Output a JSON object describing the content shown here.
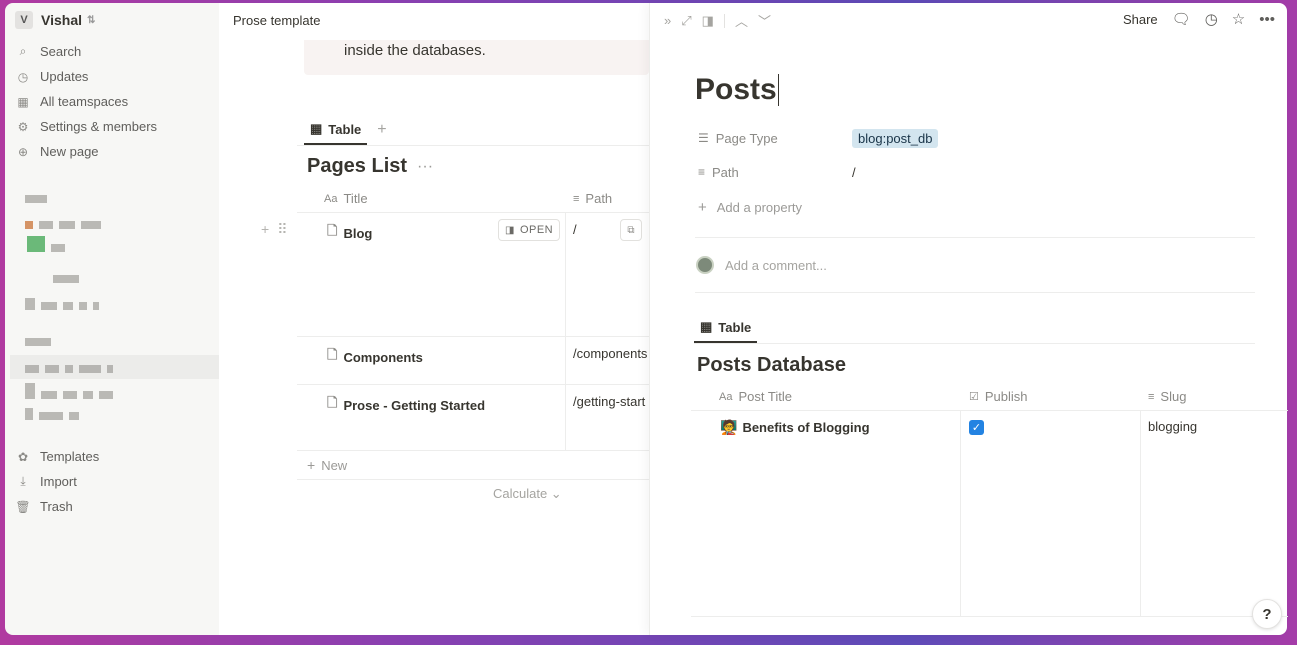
{
  "sidebar": {
    "workspace": {
      "initial": "V",
      "name": "Vishal",
      "chevron": "⇅"
    },
    "nav": [
      {
        "icon": "search-icon",
        "glyph": "⌕",
        "label": "Search"
      },
      {
        "icon": "clock-icon",
        "glyph": "◷",
        "label": "Updates"
      },
      {
        "icon": "teamspaces-icon",
        "glyph": "▦",
        "label": "All teamspaces"
      },
      {
        "icon": "gear-icon",
        "glyph": "⚙",
        "label": "Settings & members"
      },
      {
        "icon": "plus-circle-icon",
        "glyph": "⊕",
        "label": "New page"
      }
    ],
    "bottom": [
      {
        "icon": "templates-icon",
        "glyph": "✿",
        "label": "Templates"
      },
      {
        "icon": "import-icon",
        "glyph": "⤓",
        "label": "Import"
      },
      {
        "icon": "trash-icon",
        "glyph": "🗑",
        "label": "Trash"
      }
    ]
  },
  "main": {
    "header_title": "Prose template",
    "callout_text": "inside the databases.",
    "tab_label": "Table",
    "tab_add": "+",
    "db_title": "Pages List",
    "db_more": "···",
    "columns": [
      {
        "icon": "Aa",
        "label": "Title"
      },
      {
        "icon": "≡",
        "label": "Path"
      }
    ],
    "rows": [
      {
        "title": "Blog",
        "path": "/",
        "open_label": "OPEN"
      },
      {
        "title": "Components",
        "path": "/components"
      },
      {
        "title": "Prose - Getting Started",
        "path": "/getting-start"
      }
    ],
    "new_label": "New",
    "calculate_label": "Calculate ⌄"
  },
  "peek": {
    "share_label": "Share",
    "title": "Posts",
    "properties": [
      {
        "key": "Page Type",
        "icon": "☰",
        "value": "blog:post_db"
      },
      {
        "key": "Path",
        "icon": "≡",
        "value": "/"
      }
    ],
    "add_property": "Add a property",
    "comment_placeholder": "Add a comment...",
    "tab_label": "Table",
    "db_title": "Posts Database",
    "columns": [
      {
        "icon": "Aa",
        "label": "Post Title"
      },
      {
        "icon": "☑",
        "label": "Publish"
      },
      {
        "icon": "≡",
        "label": "Slug"
      }
    ],
    "rows": [
      {
        "emoji": "🧑‍🏫",
        "title": "Benefits of Blogging",
        "publish": true,
        "slug": "blogging"
      }
    ],
    "help_label": "?"
  },
  "colors": {
    "accent_blue": "#2383e2",
    "tag_bg": "#d3e5ef",
    "sidebar_bg": "#f7f7f5"
  }
}
